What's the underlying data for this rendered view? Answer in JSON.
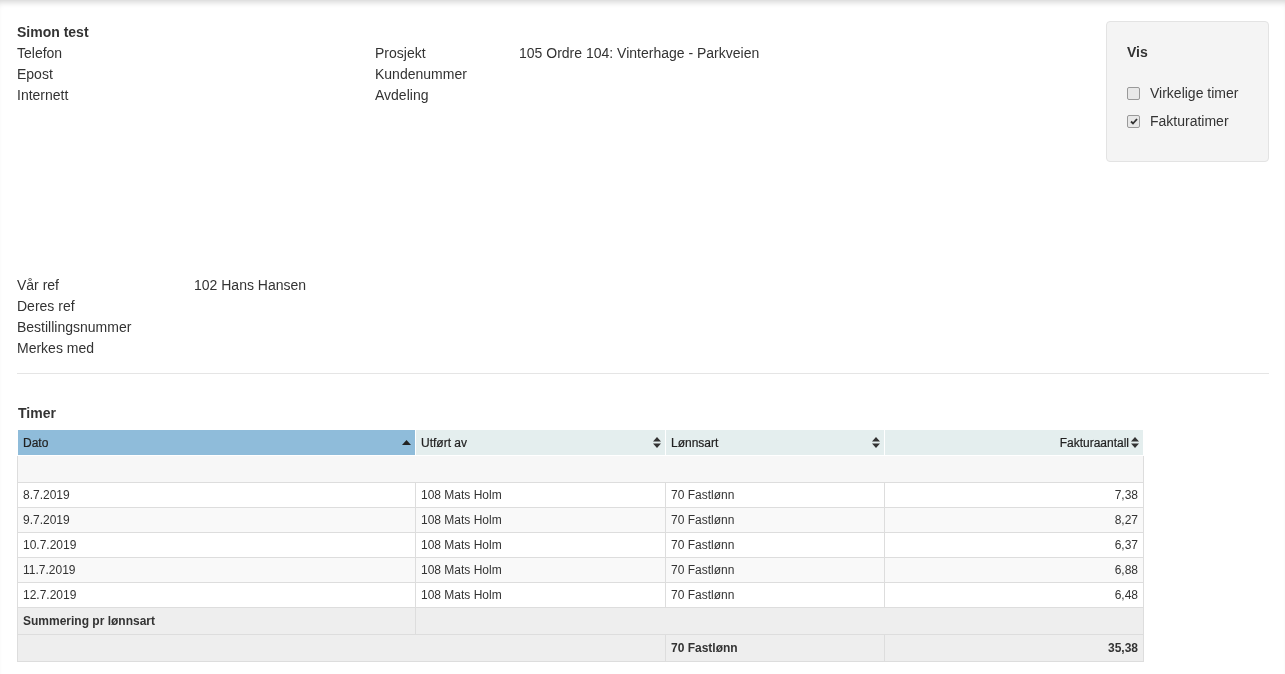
{
  "customer": {
    "name": "Simon test",
    "contact": [
      {
        "label": "Telefon"
      },
      {
        "label": "Epost"
      },
      {
        "label": "Internett"
      }
    ],
    "project": [
      {
        "label": "Prosjekt",
        "value": "105 Ordre 104: Vinterhage - Parkveien"
      },
      {
        "label": "Kundenummer"
      },
      {
        "label": "Avdeling"
      }
    ]
  },
  "vis_panel": {
    "title": "Vis",
    "options": [
      {
        "label": "Virkelige timer",
        "checked": false
      },
      {
        "label": "Fakturatimer",
        "checked": true
      }
    ]
  },
  "references": [
    {
      "label": "Vår ref",
      "value": "102 Hans Hansen"
    },
    {
      "label": "Deres ref"
    },
    {
      "label": "Bestillingsnummer"
    },
    {
      "label": "Merkes med"
    }
  ],
  "timer": {
    "title": "Timer",
    "columns": [
      {
        "label": "Dato",
        "kind": "text",
        "selected": true
      },
      {
        "label": "Utført av",
        "kind": "text",
        "selected": false
      },
      {
        "label": "Lønnsart",
        "kind": "text",
        "selected": false
      },
      {
        "label": "Fakturaantall",
        "kind": "number",
        "selected": false
      }
    ],
    "rows": [
      [
        "8.7.2019",
        "108 Mats Holm",
        "70 Fastlønn",
        "7,38"
      ],
      [
        "9.7.2019",
        "108 Mats Holm",
        "70 Fastlønn",
        "8,27"
      ],
      [
        "10.7.2019",
        "108 Mats Holm",
        "70 Fastlønn",
        "6,37"
      ],
      [
        "11.7.2019",
        "108 Mats Holm",
        "70 Fastlønn",
        "6,88"
      ],
      [
        "12.7.2019",
        "108 Mats Holm",
        "70 Fastlønn",
        "6,48"
      ]
    ],
    "summary_title": "Summering pr lønnsart",
    "summary_rows": [
      {
        "lonnsart": "70 Fastlønn",
        "total": "35,38"
      }
    ]
  }
}
